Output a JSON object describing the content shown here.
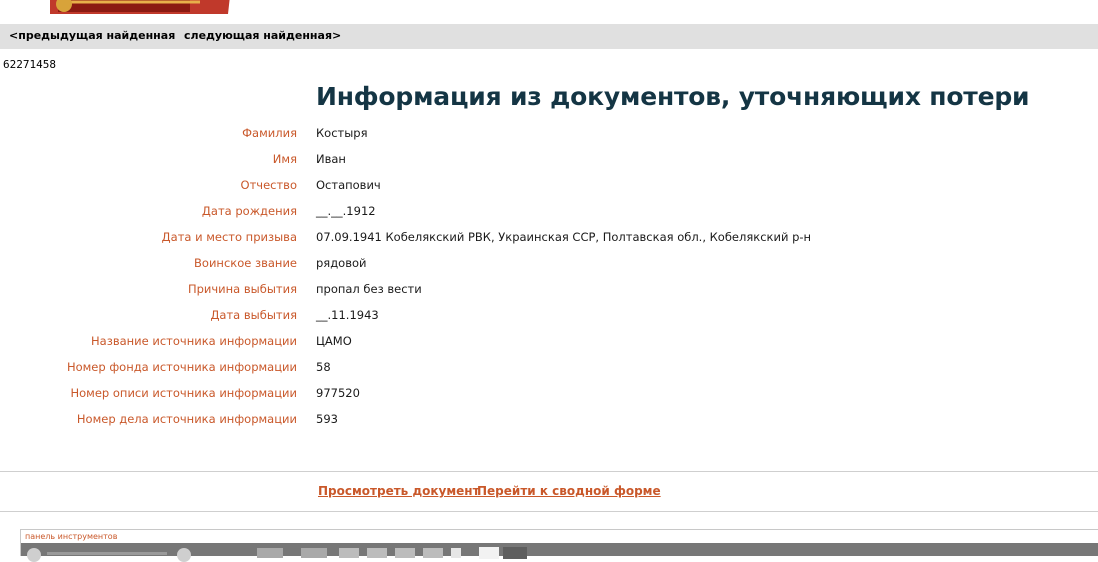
{
  "navigation": {
    "prev_label": "<предыдущая найденная",
    "next_label": "следующая найденная>"
  },
  "record_id": "62271458",
  "page_title": "Информация из документов, уточняющих потери",
  "fields": [
    {
      "label": "Фамилия",
      "value": "Костыря"
    },
    {
      "label": "Имя",
      "value": "Иван"
    },
    {
      "label": "Отчество",
      "value": "Остапович"
    },
    {
      "label": "Дата рождения",
      "value": "__.__.1912"
    },
    {
      "label": "Дата и место призыва",
      "value": "07.09.1941 Кобелякский РВК, Украинская ССР, Полтавская обл., Кобелякский р-н"
    },
    {
      "label": "Воинское звание",
      "value": "рядовой"
    },
    {
      "label": "Причина выбытия",
      "value": "пропал без вести"
    },
    {
      "label": "Дата выбытия",
      "value": "__.11.1943"
    },
    {
      "label": "Название источника информации",
      "value": "ЦАМО"
    },
    {
      "label": "Номер фонда источника информации",
      "value": "58"
    },
    {
      "label": "Номер описи источника информации",
      "value": "977520"
    },
    {
      "label": "Номер дела источника информации",
      "value": "593"
    }
  ],
  "actions": {
    "view_document": "Просмотреть документ",
    "summary_form": "Перейти к сводной форме"
  },
  "tools_panel": {
    "caption": "панель инструментов"
  },
  "colors": {
    "label": "#c9582a",
    "title": "#143544",
    "navbar_bg": "#e0e0e0",
    "link": "#c9582a"
  },
  "icons": {
    "logo": "site-logo",
    "zoom_out": "zoom-out-icon",
    "zoom_in": "zoom-in-icon"
  }
}
